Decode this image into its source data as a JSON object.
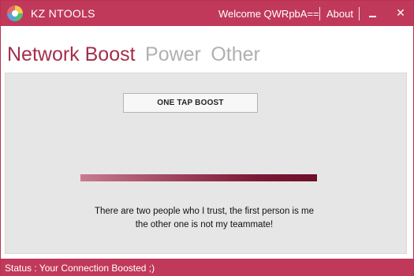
{
  "titlebar": {
    "app_title": "KZ NTOOLS",
    "welcome_text": "Welcome QWRpbA==",
    "about_label": "About",
    "minimize_icon": "minimize-icon",
    "close_icon": "close-icon",
    "close_glyph": "✕"
  },
  "tabs": [
    {
      "label": "Network Boost",
      "active": true
    },
    {
      "label": "Power",
      "active": false
    },
    {
      "label": "Other",
      "active": false
    }
  ],
  "main": {
    "boost_button_label": "ONE TAP BOOST",
    "progress": 1.0,
    "message_line1": "There are two people who I trust, the first person is me",
    "message_line2": "the other one is not my teammate!"
  },
  "status": {
    "text": "Status : Your Connection Boosted ;)"
  },
  "colors": {
    "accent": "#c0395a",
    "active_tab": "#a52e4c",
    "inactive_tab": "#b0b0b0",
    "progress_dark": "#6d0f2a"
  }
}
